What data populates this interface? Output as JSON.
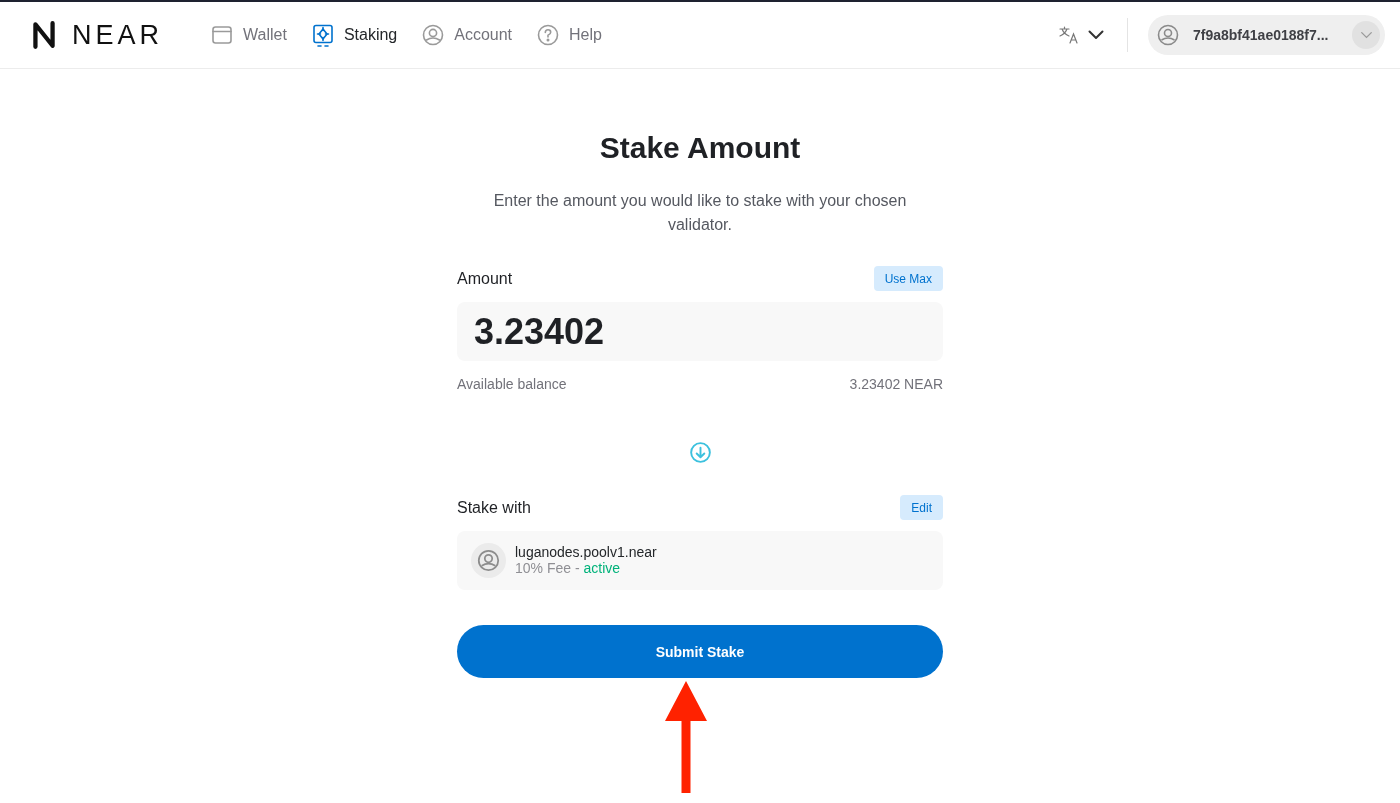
{
  "header": {
    "logo": "NEAR",
    "nav": [
      {
        "label": "Wallet",
        "selected": false
      },
      {
        "label": "Staking",
        "selected": true
      },
      {
        "label": "Account",
        "selected": false
      },
      {
        "label": "Help",
        "selected": false
      }
    ],
    "account": {
      "id": "7f9a8bf41ae0188f7..."
    }
  },
  "stake": {
    "title": "Stake Amount",
    "description": "Enter the amount you would like to stake with your chosen validator.",
    "amount": {
      "label": "Amount",
      "button": "Use Max",
      "value": "3.23402",
      "balance_label": "Available balance",
      "balance": "3.23402 NEAR"
    },
    "validator": {
      "label": "Stake with",
      "button": "Edit",
      "name": "luganodes.poolv1.near",
      "fee": "10% Fee -",
      "status": {
        "label": "active",
        "ok": true
      }
    },
    "submit": "Submit Stake"
  }
}
